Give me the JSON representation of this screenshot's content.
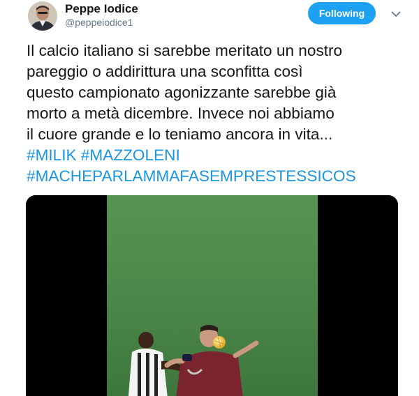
{
  "user": {
    "name": "Peppe Iodice",
    "handle": "@peppeiodice1"
  },
  "follow_label": "Following",
  "icons": {
    "avatar": "avatar-photo",
    "caret": "chevron-down-icon"
  },
  "tweet": {
    "lines": [
      "Il calcio italiano si sarebbe meritato un nostro",
      "pareggio o addirittura una sconfitta così",
      "questo campionato agonizzante sarebbe già",
      "morto a metà dicembre. Invece noi abbiamo",
      "il cuore grande e lo teniamo ancora in vita..."
    ],
    "hashtags": {
      "milik": "#MILIK",
      "mazzoleni": "#MAZZOLENI",
      "macheparlamma": "#MACHEPARLAMMAFASEMPRESTESSICOS"
    }
  },
  "colors": {
    "accent": "#1da1f2",
    "hashtag": "#1b95e0",
    "text": "#14171a",
    "muted": "#657786"
  }
}
